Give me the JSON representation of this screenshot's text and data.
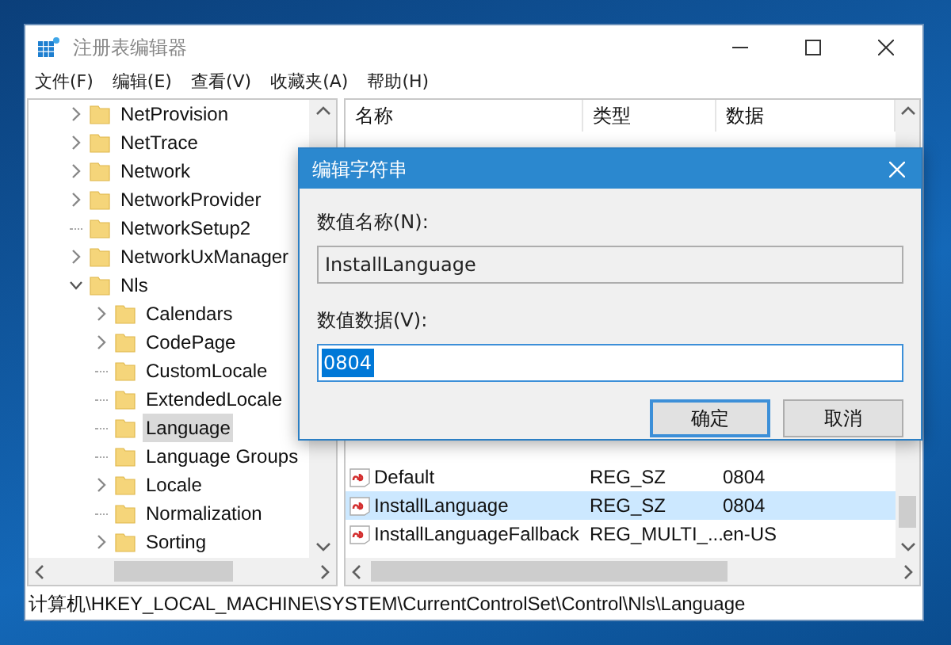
{
  "window": {
    "title": "注册表编辑器"
  },
  "menu": [
    "文件(F)",
    "编辑(E)",
    "查看(V)",
    "收藏夹(A)",
    "帮助(H)"
  ],
  "tree": {
    "items": [
      {
        "label": "NetProvision",
        "expanded": false,
        "selected": false
      },
      {
        "label": "NetTrace",
        "expanded": false,
        "selected": false
      },
      {
        "label": "Network",
        "expanded": false,
        "selected": false
      },
      {
        "label": "NetworkProvider",
        "expanded": false,
        "selected": false
      },
      {
        "label": "NetworkSetup2",
        "selected": false
      },
      {
        "label": "NetworkUxManager",
        "expanded": false,
        "selected": false
      },
      {
        "label": "Nls",
        "expanded": true,
        "selected": false,
        "children": [
          {
            "label": "Calendars",
            "expanded": false,
            "selected": false
          },
          {
            "label": "CodePage",
            "expanded": false,
            "selected": false
          },
          {
            "label": "CustomLocale",
            "selected": false
          },
          {
            "label": "ExtendedLocale",
            "selected": false
          },
          {
            "label": "Language",
            "selected": true
          },
          {
            "label": "Language Groups",
            "selected": false
          },
          {
            "label": "Locale",
            "expanded": false,
            "selected": false
          },
          {
            "label": "Normalization",
            "selected": false
          },
          {
            "label": "Sorting",
            "expanded": false,
            "selected": false
          }
        ]
      }
    ]
  },
  "list": {
    "columns": [
      "名称",
      "类型",
      "数据"
    ],
    "rows": [
      {
        "name": "Default",
        "type": "REG_SZ",
        "data": "0804",
        "selected": false
      },
      {
        "name": "InstallLanguage",
        "type": "REG_SZ",
        "data": "0804",
        "selected": true
      },
      {
        "name": "InstallLanguageFallback",
        "type": "REG_MULTI_...",
        "data": "en-US",
        "selected": false
      }
    ]
  },
  "status_bar": "计算机\\HKEY_LOCAL_MACHINE\\SYSTEM\\CurrentControlSet\\Control\\Nls\\Language",
  "dialog": {
    "title": "编辑字符串",
    "name_label": "数值名称(N):",
    "name_value": "InstallLanguage",
    "data_label": "数值数据(V):",
    "data_value": "0804",
    "buttons": [
      {
        "label": "确定",
        "default": true
      },
      {
        "label": "取消",
        "default": false
      }
    ]
  }
}
